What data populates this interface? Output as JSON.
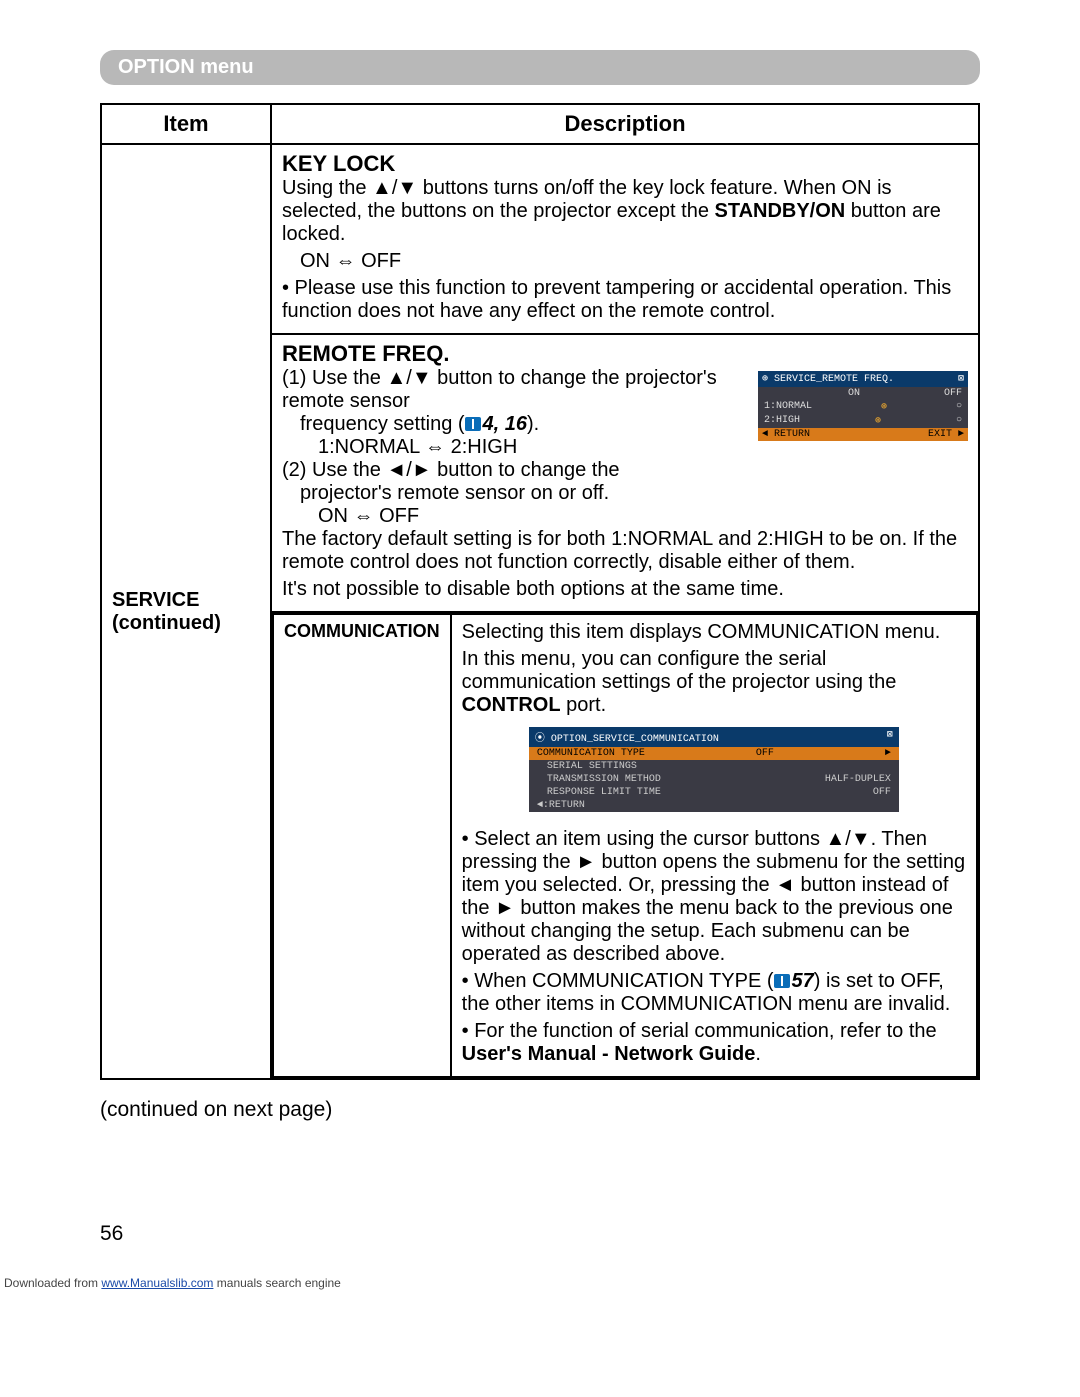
{
  "banner": "OPTION menu",
  "headers": {
    "item": "Item",
    "desc": "Description"
  },
  "item_cell": {
    "title": "SERVICE",
    "sub": "(continued)"
  },
  "keylock": {
    "title": "KEY LOCK",
    "p1a": "Using the ▲/▼ buttons turns on/off the key lock feature. When ON is selected, the buttons on the projector except the ",
    "p1b": "STANDBY/ON",
    "p1c": " button are locked.",
    "toggle": "ON ⇔ OFF",
    "p2": "• Please use this function to prevent tampering or accidental operation. This function does not have any effect on the remote control."
  },
  "remote": {
    "title": "REMOTE FREQ.",
    "l1": "(1) Use the ▲/▼ button to change the projector's remote sensor",
    "l1b_a": "frequency setting (",
    "l1b_ref": "4, 16",
    "l1b_b": ").",
    "toggle1": "1:NORMAL ⇔ 2:HIGH",
    "l2": "(2) Use the ◄/► button to change the",
    "l2b": "projector's remote sensor on or off.",
    "toggle2": "ON ⇔ OFF",
    "p3": "The factory default setting is for both 1:NORMAL and 2:HIGH to be on. If the remote control does not function correctly, disable either of them.",
    "p4": "It's not possible to disable both options at the same time.",
    "osd": {
      "title_l": "⊕ SERVICE_REMOTE FREQ.",
      "title_r": "⊠",
      "r1a": "1:NORMAL",
      "r1b": "ON",
      "r1c": "OFF",
      "r2a": "2:HIGH",
      "r2b": "⊛",
      "r2c": "○",
      "r3b": "⊛",
      "r3c": "○",
      "fa": "◄ RETURN",
      "fb": "EXIT ►"
    }
  },
  "comm": {
    "label": "COMMUNICATION",
    "p1a": "Selecting this item displays COMMUNICATION menu.",
    "p1b": "In this menu, you can configure the serial communication settings of the projector using the ",
    "p1c": "CONTROL",
    "p1d": " port.",
    "p2": "• Select an item using the cursor buttons ▲/▼. Then pressing the ► button opens the submenu for the setting item you selected. Or, pressing the ◄ button instead of the ► button makes the menu back to the previous one without changing the setup. Each submenu can be operated as described above.",
    "p3a": "• When COMMUNICATION TYPE (",
    "p3ref": "57",
    "p3b": ") is set to OFF, the other items in COMMUNICATION menu are invalid.",
    "p4a": "• For the function of serial communication, refer to the ",
    "p4b": "User's Manual - Network Guide",
    "p4c": ".",
    "osd": {
      "bar_l": "⦿ OPTION_SERVICE_COMMUNICATION",
      "bar_r": "⊠",
      "hi_a": "COMMUNICATION TYPE",
      "hi_b": "OFF",
      "hi_c": "►",
      "r1": "SERIAL SETTINGS",
      "r2a": "TRANSMISSION METHOD",
      "r2b": "HALF-DUPLEX",
      "r3a": "RESPONSE LIMIT TIME",
      "r3b": "OFF",
      "rtn": "◄:RETURN"
    }
  },
  "continued": "(continued on next page)",
  "page_number": "56",
  "footer": {
    "a": "Downloaded from ",
    "link": "www.Manualslib.com",
    "b": " manuals search engine"
  }
}
